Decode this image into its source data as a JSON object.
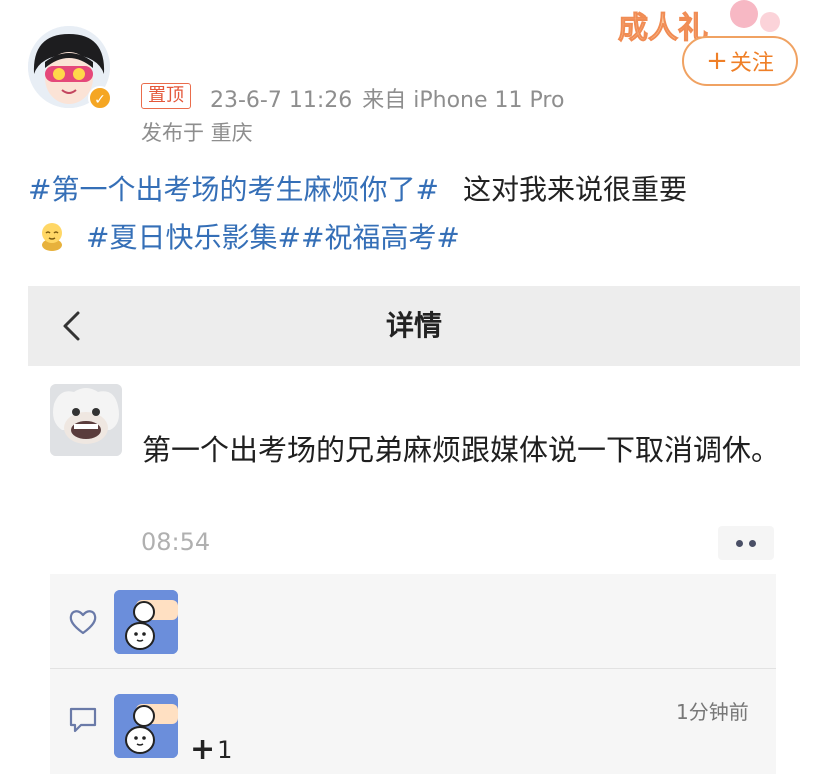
{
  "post": {
    "pin_label": "置顶",
    "date": "23-6-7 11:26",
    "source": "来自 iPhone 11 Pro",
    "location": "发布于 重庆",
    "follow_label": "关注",
    "follow_plus": "+",
    "verified_icon": "verified-badge-icon",
    "deco_text": "成人礼",
    "topic1": "#第一个出考场的考生麻烦你了#",
    "text": "这对我来说很重要",
    "topic2": "#夏日快乐影集#",
    "topic3": "#祝福高考#",
    "accent_color": "#ef7f27",
    "topic_color": "#356fb7"
  },
  "embed": {
    "title": "详情",
    "message": "第一个出考场的兄弟麻烦跟媒体说一下取消调休。",
    "time": "08:54",
    "comment_time": "1分钟前",
    "plus_symbol": "+",
    "plus_count": "1"
  }
}
